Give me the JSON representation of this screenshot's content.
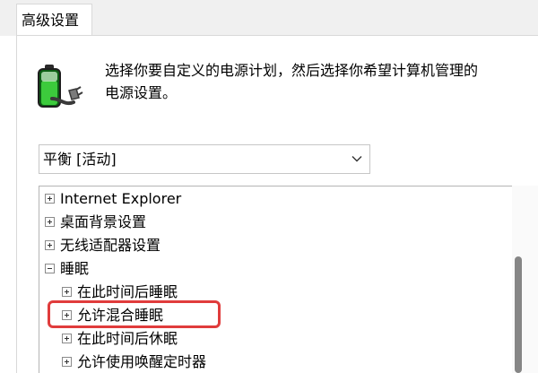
{
  "window": {
    "tab_label": "高级设置"
  },
  "header": {
    "description_line1": "选择你要自定义的电源计划，然后选择你希望计算机管理的",
    "description_line2": "电源设置。",
    "icon": "battery-plug-icon"
  },
  "plan": {
    "selected": "平衡 [活动]"
  },
  "tree": {
    "items": [
      {
        "label": "Internet Explorer",
        "state": "collapsed"
      },
      {
        "label": "桌面背景设置",
        "state": "collapsed"
      },
      {
        "label": "无线适配器设置",
        "state": "collapsed"
      },
      {
        "label": "睡眠",
        "state": "expanded"
      },
      {
        "label": "在此时间后睡眠",
        "state": "collapsed"
      },
      {
        "label": "允许混合睡眠",
        "state": "collapsed"
      },
      {
        "label": "在此时间后休眠",
        "state": "collapsed"
      },
      {
        "label": "允许使用唤醒定时器",
        "state": "collapsed"
      }
    ]
  },
  "colors": {
    "highlight": "#e03c3c",
    "tab_bg": "#f0f0f0"
  }
}
